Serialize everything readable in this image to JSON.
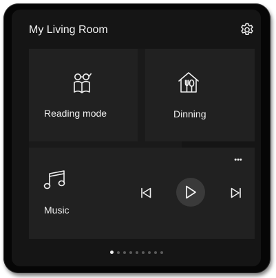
{
  "header": {
    "title": "My Living Room"
  },
  "icons": {
    "settings": "gear-icon",
    "reading": "reading-glasses-book-icon",
    "dinning": "house-fork-spoon-icon",
    "music": "music-note-icon",
    "more": "more-dots-icon",
    "prev": "skip-previous-icon",
    "play": "play-icon",
    "next": "skip-next-icon"
  },
  "tiles": {
    "reading": {
      "label": "Reading mode"
    },
    "dinning": {
      "label": "Dinning"
    },
    "music": {
      "label": "Music",
      "more": "•••"
    }
  },
  "pager": {
    "total": 9,
    "active": 1
  },
  "colors": {
    "bezel": "#060606",
    "screen": "#151515",
    "tile": "#212121",
    "play_button": "#3a3a3a",
    "text": "#f2f2f2"
  }
}
